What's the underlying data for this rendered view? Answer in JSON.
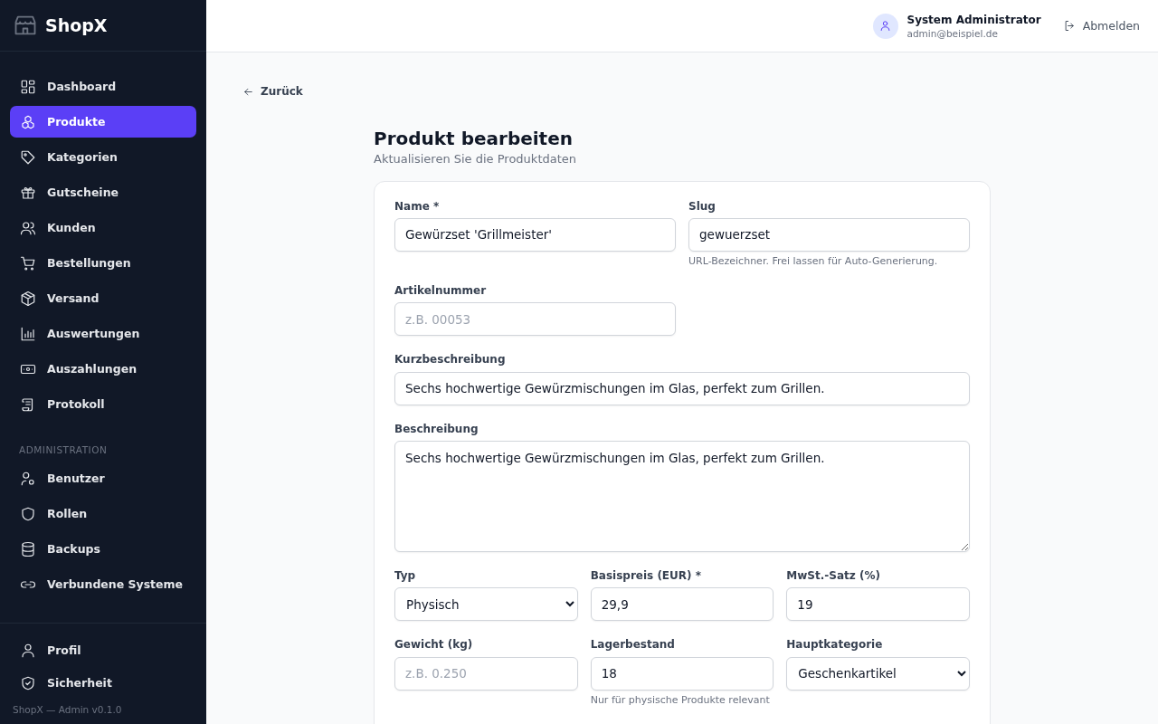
{
  "sidebar": {
    "brand": "ShopX",
    "items": [
      {
        "label": "Dashboard",
        "selected": false
      },
      {
        "label": "Produkte",
        "selected": true
      },
      {
        "label": "Kategorien",
        "selected": false
      },
      {
        "label": "Gutscheine",
        "selected": false
      },
      {
        "label": "Kunden",
        "selected": false
      },
      {
        "label": "Bestellungen",
        "selected": false
      },
      {
        "label": "Versand",
        "selected": false
      },
      {
        "label": "Auswertungen",
        "selected": false
      },
      {
        "label": "Auszahlungen",
        "selected": false
      },
      {
        "label": "Protokoll",
        "selected": false
      }
    ],
    "section_title": "ADMINISTRATION",
    "admin_items": [
      {
        "label": "Benutzer",
        "selected": false
      },
      {
        "label": "Rollen",
        "selected": false
      },
      {
        "label": "Backups",
        "selected": false
      },
      {
        "label": "Verbundene Systeme",
        "selected": false
      }
    ],
    "bottom_items": [
      {
        "label": "Profil",
        "selected": false
      },
      {
        "label": "Sicherheit",
        "selected": false
      }
    ],
    "version": "ShopX — Admin v0.1.0"
  },
  "header": {
    "user_name": "System Administrator",
    "user_email": "admin@beispiel.de",
    "logout": "Abmelden"
  },
  "back_link": "Zurück",
  "page": {
    "title": "Produkt bearbeiten",
    "subtitle": "Aktualisieren Sie die Produktdaten"
  },
  "form": {
    "rows": [
      {
        "kind": "pair",
        "fields": [
          {
            "kind": "text",
            "label": "Name *",
            "value": "Gewürzset 'Grillmeister'"
          },
          {
            "kind": "text",
            "label": "Slug",
            "value": "gewuerzset",
            "hint": "URL-Bezeichner. Frei lassen für Auto-Generierung."
          }
        ]
      },
      {
        "kind": "pair",
        "fields": [
          {
            "kind": "text",
            "label": "Artikelnummer",
            "placeholder": "z.B. 00053"
          }
        ]
      },
      {
        "kind": "full",
        "fields": [
          {
            "kind": "text",
            "label": "Kurzbeschreibung",
            "value": "Sechs hochwertige Gewürzmischungen im Glas, perfekt zum Grillen."
          }
        ]
      },
      {
        "kind": "full",
        "fields": [
          {
            "kind": "textarea",
            "label": "Beschreibung",
            "value": "Sechs hochwertige Gewürzmischungen im Glas, perfekt zum Grillen."
          }
        ]
      },
      {
        "kind": "triple",
        "fields": [
          {
            "kind": "select",
            "label": "Typ",
            "value": "Physisch"
          },
          {
            "kind": "text",
            "label": "Basispreis (EUR) *",
            "value": "29,9"
          },
          {
            "kind": "text",
            "label": "MwSt.-Satz (%)",
            "value": "19"
          }
        ]
      },
      {
        "kind": "triple",
        "fields": [
          {
            "kind": "text",
            "label": "Gewicht (kg)",
            "placeholder": "z.B. 0.250"
          },
          {
            "kind": "text",
            "label": "Lagerbestand",
            "value": "18",
            "hint": "Nur für physische Produkte relevant"
          },
          {
            "kind": "select",
            "label": "Hauptkategorie",
            "value": "Geschenkartikel"
          }
        ]
      }
    ]
  }
}
